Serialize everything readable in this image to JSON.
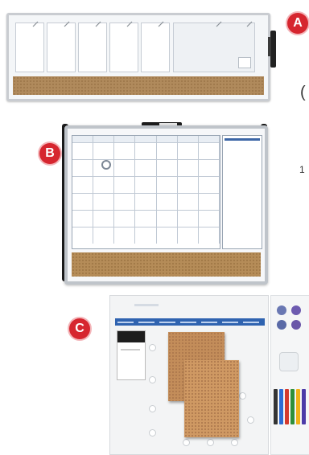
{
  "badges": {
    "a": "A",
    "b": "B",
    "c": "C"
  },
  "side_text": {
    "paren": "(",
    "one": "1"
  },
  "colors": {
    "badge_red": "#d6262f",
    "cork": "#b08a5c",
    "frame_silver": "#c9ccd1",
    "calendar_blue": "#3c66a6"
  },
  "icons": {
    "a_marker": "marker-icon",
    "b_magnet": "magnet-icon",
    "c_pins": "pushpin-icon",
    "c_markers": "marker-icon"
  }
}
